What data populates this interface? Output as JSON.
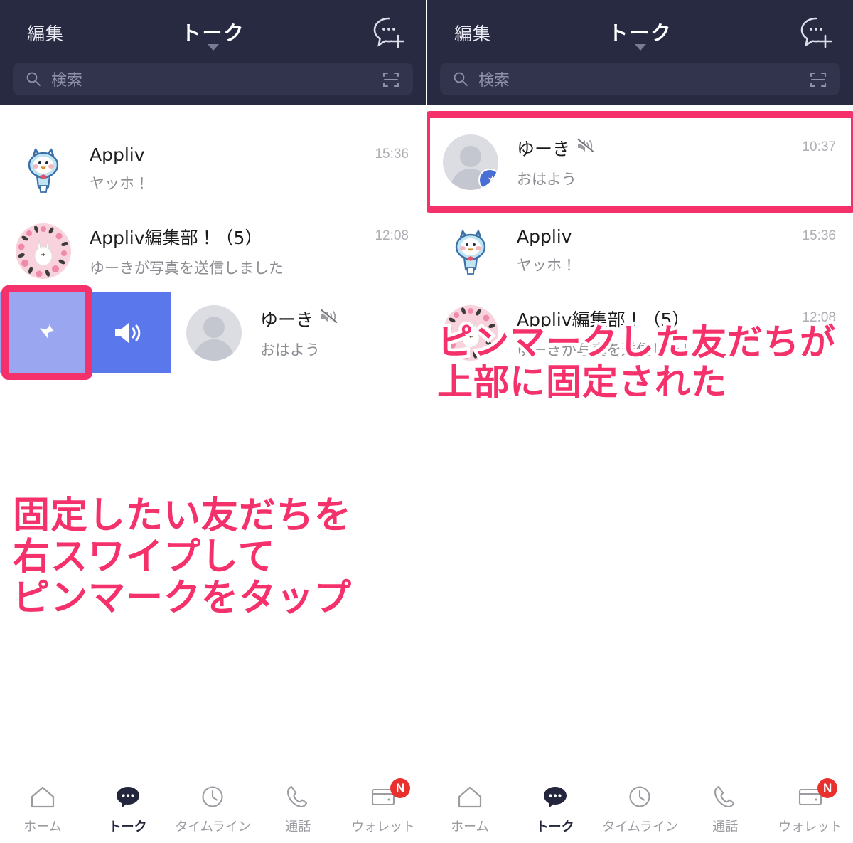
{
  "header": {
    "edit_label": "編集",
    "title": "トーク",
    "dropdown_icon": "chevron-down-icon",
    "new_chat_icon": "new-chat-icon"
  },
  "search": {
    "placeholder": "検索",
    "search_icon": "search-icon",
    "qr_icon": "qr-scan-icon"
  },
  "left_panel": {
    "chats": [
      {
        "name": "Appliv",
        "message": "ヤッホ！",
        "time": "15:36",
        "avatar": "appliv-bird-avatar",
        "muted": false,
        "pinned": false
      },
      {
        "name": "Appliv編集部！（5）",
        "message": "ゆーきが写真を送信しました",
        "time": "12:08",
        "avatar": "cony-floral-avatar",
        "muted": false,
        "pinned": false
      },
      {
        "name": "ゆーき",
        "message": "おはよう",
        "time": "",
        "avatar": "default-person-avatar",
        "muted": true,
        "pinned": false
      }
    ],
    "swipe_actions": [
      {
        "name": "pin-action",
        "icon": "pin-icon",
        "color": "#9aa6ef",
        "highlighted": true
      },
      {
        "name": "unmute-action",
        "icon": "speaker-icon",
        "color": "#5a77ec",
        "highlighted": false
      }
    ],
    "annotation": "固定したい友だちを\n右スワイプして\nピンマークをタップ"
  },
  "right_panel": {
    "chats": [
      {
        "name": "ゆーき",
        "message": "おはよう",
        "time": "10:37",
        "avatar": "default-person-avatar",
        "muted": true,
        "pinned": true
      },
      {
        "name": "Appliv",
        "message": "ヤッホ！",
        "time": "15:36",
        "avatar": "appliv-bird-avatar",
        "muted": false,
        "pinned": false
      },
      {
        "name": "Appliv編集部！（5）",
        "message": "ゆーきが写真を送信しました",
        "time": "12:08",
        "avatar": "cony-floral-avatar",
        "muted": false,
        "pinned": false
      }
    ],
    "annotation": "ピンマークした友だちが\n上部に固定された"
  },
  "tabs": [
    {
      "label": "ホーム",
      "icon": "home-icon",
      "active": false,
      "badge": ""
    },
    {
      "label": "トーク",
      "icon": "chat-bubble-icon",
      "active": true,
      "badge": ""
    },
    {
      "label": "タイムライン",
      "icon": "clock-icon",
      "active": false,
      "badge": ""
    },
    {
      "label": "通話",
      "icon": "phone-icon",
      "active": false,
      "badge": ""
    },
    {
      "label": "ウォレット",
      "icon": "wallet-icon",
      "active": false,
      "badge": "N"
    }
  ],
  "colors": {
    "header_bg": "#272a41",
    "search_bg": "#31344c",
    "highlight_pink": "#f5316b",
    "pin_action": "#9aa6ef",
    "mute_action": "#5a77ec",
    "pin_badge": "#4a6fd4",
    "badge_red": "#e8312f"
  }
}
